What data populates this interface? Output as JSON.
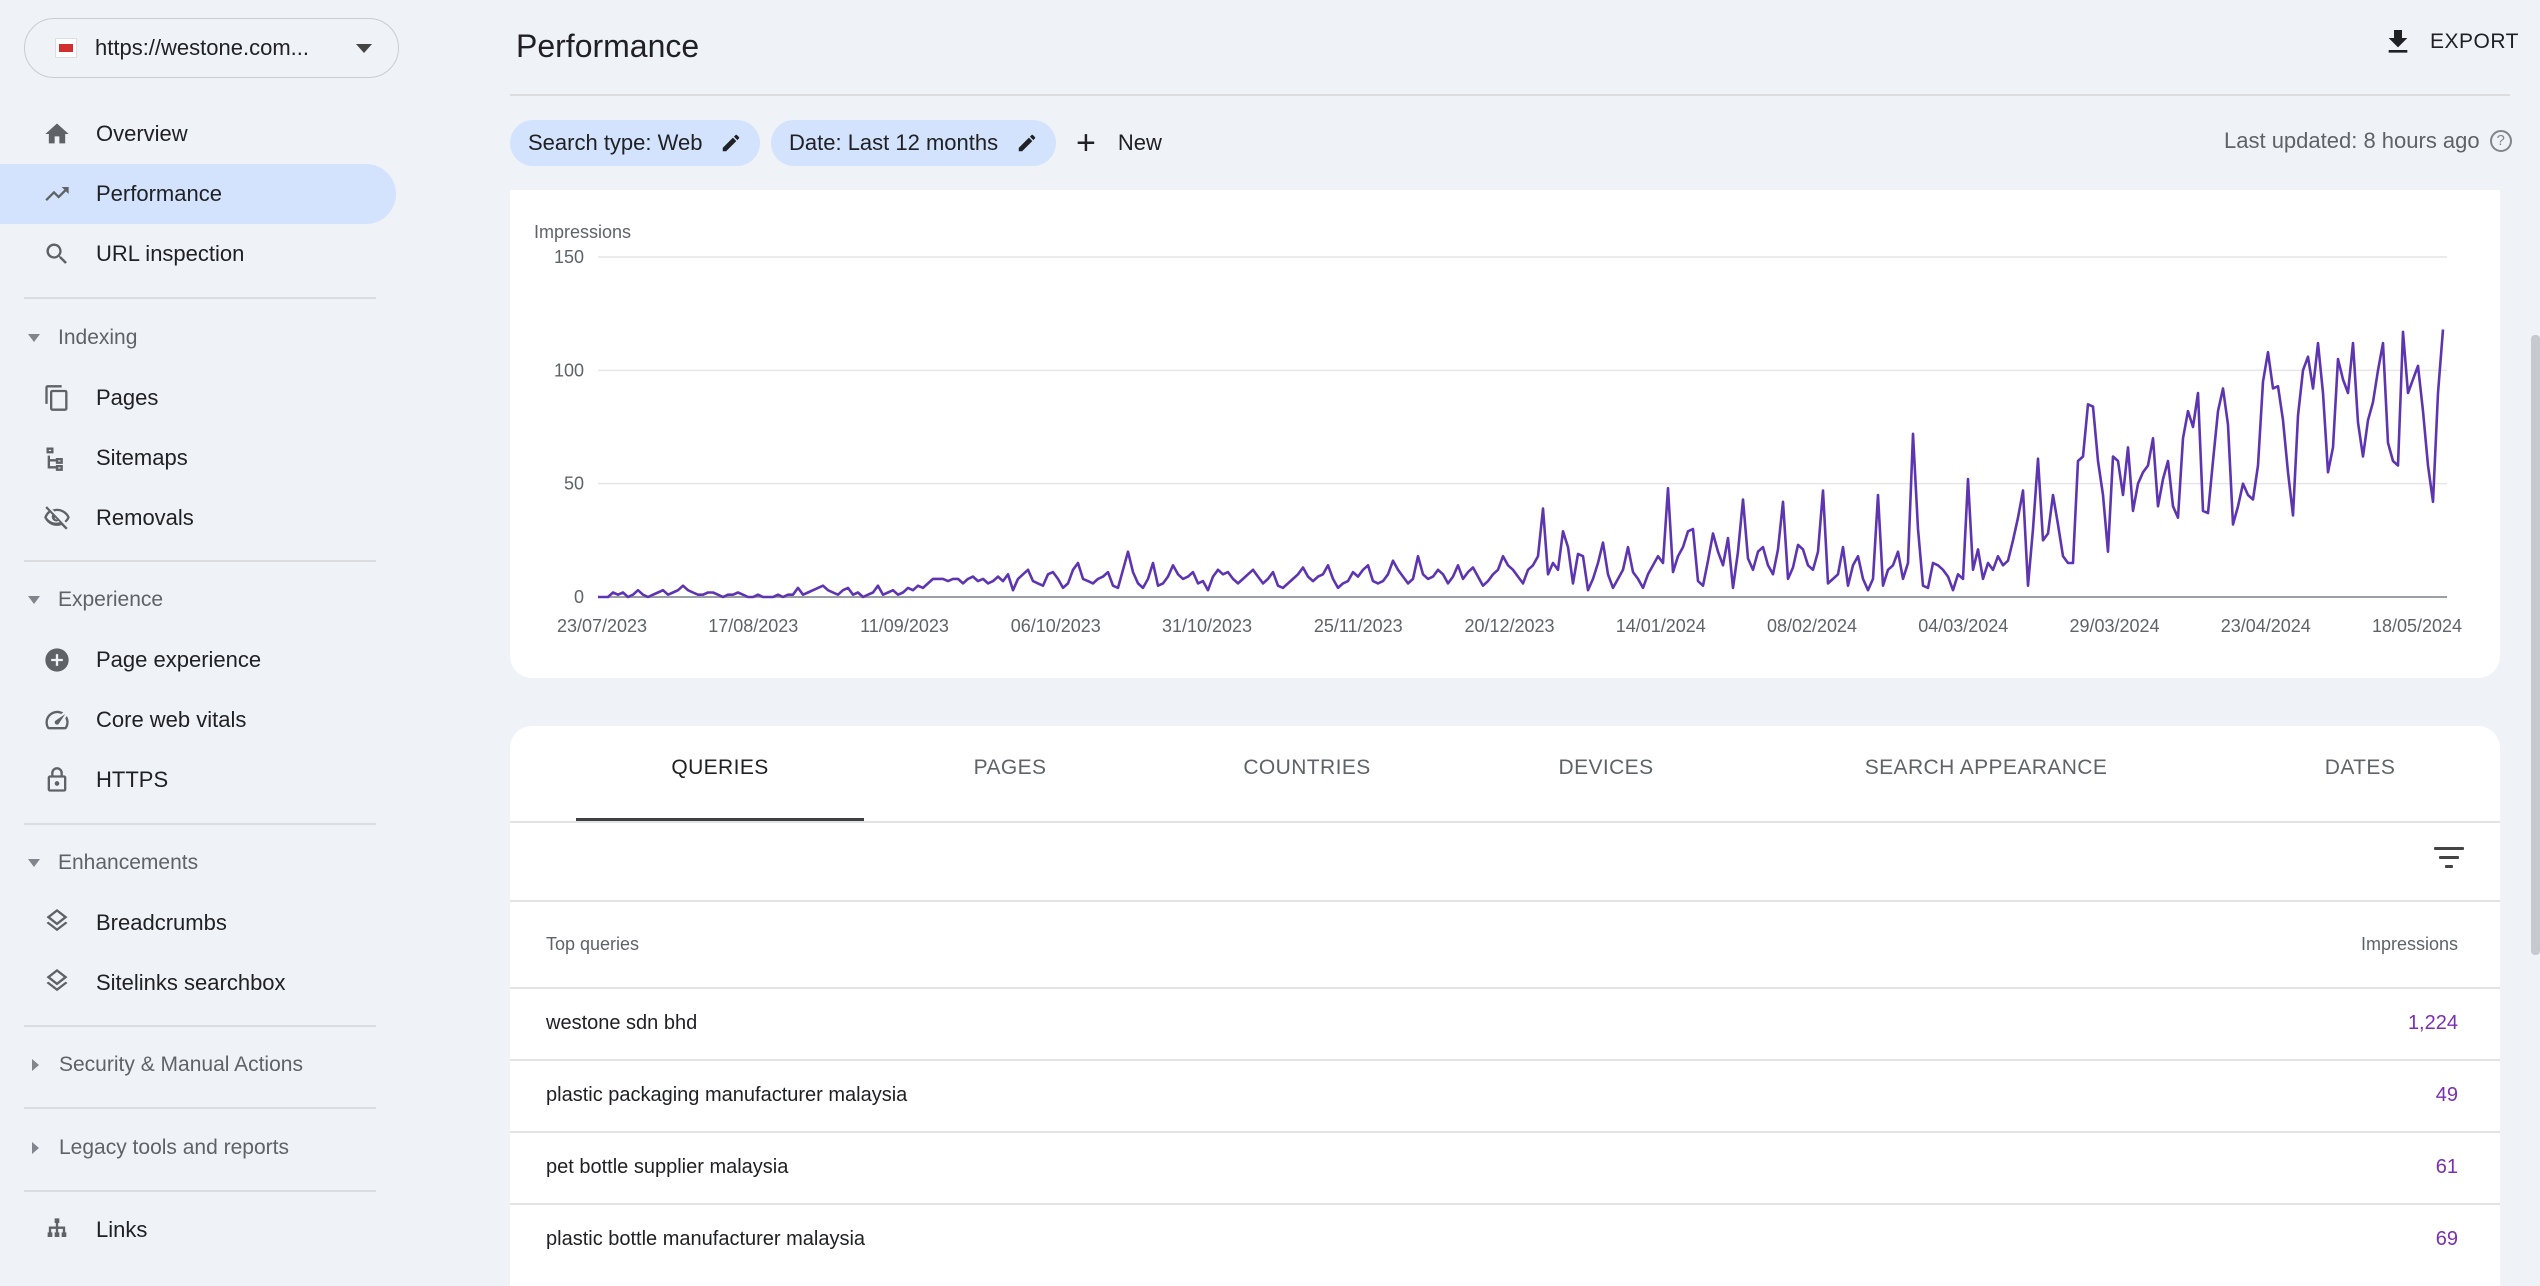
{
  "property": {
    "url": "https://westone.com..."
  },
  "sidebar": {
    "overview": "Overview",
    "performance": "Performance",
    "url_inspection": "URL inspection",
    "indexing": {
      "title": "Indexing",
      "pages": "Pages",
      "sitemaps": "Sitemaps",
      "removals": "Removals"
    },
    "experience": {
      "title": "Experience",
      "page_experience": "Page experience",
      "core_web_vitals": "Core web vitals",
      "https": "HTTPS"
    },
    "enhancements": {
      "title": "Enhancements",
      "breadcrumbs": "Breadcrumbs",
      "sitelinks": "Sitelinks searchbox"
    },
    "security": "Security & Manual Actions",
    "legacy": "Legacy tools and reports",
    "links": "Links"
  },
  "header": {
    "title": "Performance",
    "export": "EXPORT"
  },
  "filters": {
    "search_type": "Search type: Web",
    "date": "Date: Last 12 months",
    "new": "New",
    "last_updated": "Last updated: 8 hours ago"
  },
  "chart_data": {
    "type": "line",
    "ylabel": "Impressions",
    "ylim": [
      0,
      150
    ],
    "yticks": [
      "0",
      "50",
      "100",
      "150"
    ],
    "xticks": [
      "23/07/2023",
      "17/08/2023",
      "11/09/2023",
      "06/10/2023",
      "31/10/2023",
      "25/11/2023",
      "20/12/2023",
      "14/01/2024",
      "08/02/2024",
      "04/03/2024",
      "29/03/2024",
      "23/04/2024",
      "18/05/2024"
    ],
    "x_start": "23/07/2023",
    "x_end": "20/05/2024",
    "color": "#5e35b1",
    "series": [
      {
        "values": [
          0,
          0,
          0,
          2,
          1,
          2,
          0,
          1,
          3,
          1,
          0,
          1,
          2,
          3,
          1,
          2,
          3,
          5,
          3,
          2,
          1,
          1,
          2,
          2,
          1,
          0,
          1,
          1,
          2,
          1,
          0,
          0,
          1,
          0,
          0,
          0,
          1,
          0,
          1,
          1,
          4,
          1,
          2,
          3,
          4,
          5,
          3,
          2,
          1,
          3,
          4,
          1,
          2,
          0,
          1,
          2,
          5,
          1,
          2,
          3,
          1,
          2,
          4,
          3,
          5,
          4,
          6,
          8,
          8,
          8,
          7,
          8,
          8,
          6,
          8,
          9,
          7,
          8,
          6,
          7,
          9,
          7,
          10,
          3,
          8,
          10,
          12,
          7,
          6,
          5,
          10,
          11,
          8,
          4,
          6,
          12,
          15,
          8,
          7,
          6,
          8,
          9,
          11,
          5,
          4,
          12,
          20,
          11,
          6,
          4,
          8,
          15,
          5,
          6,
          9,
          14,
          10,
          8,
          9,
          11,
          6,
          7,
          3,
          9,
          12,
          10,
          11,
          8,
          6,
          8,
          10,
          12,
          9,
          6,
          8,
          11,
          5,
          4,
          6,
          8,
          10,
          13,
          9,
          7,
          9,
          10,
          14,
          8,
          4,
          6,
          7,
          11,
          9,
          12,
          14,
          7,
          6,
          7,
          10,
          16,
          12,
          9,
          6,
          8,
          18,
          10,
          8,
          9,
          12,
          10,
          6,
          9,
          14,
          8,
          11,
          13,
          9,
          5,
          7,
          10,
          12,
          18,
          14,
          12,
          9,
          6,
          12,
          14,
          18,
          39,
          10,
          15,
          12,
          29,
          22,
          6,
          19,
          18,
          3,
          8,
          15,
          24,
          10,
          4,
          8,
          12,
          22,
          11,
          8,
          4,
          10,
          14,
          18,
          15,
          48,
          11,
          18,
          22,
          29,
          30,
          7,
          5,
          16,
          28,
          20,
          14,
          26,
          4,
          20,
          43,
          17,
          12,
          20,
          22,
          14,
          10,
          21,
          42,
          8,
          13,
          23,
          21,
          14,
          12,
          20,
          47,
          6,
          8,
          10,
          22,
          5,
          14,
          18,
          8,
          3,
          8,
          45,
          5,
          12,
          14,
          20,
          8,
          15,
          72,
          30,
          5,
          4,
          15,
          14,
          12,
          9,
          3,
          10,
          8,
          52,
          12,
          21,
          8,
          15,
          12,
          18,
          14,
          16,
          25,
          35,
          47,
          5,
          30,
          61,
          25,
          28,
          45,
          32,
          18,
          15,
          15,
          60,
          62,
          85,
          84,
          60,
          45,
          20,
          62,
          60,
          45,
          66,
          38,
          50,
          55,
          58,
          70,
          40,
          52,
          60,
          40,
          35,
          70,
          82,
          75,
          90,
          38,
          37,
          60,
          82,
          92,
          76,
          32,
          40,
          50,
          45,
          43,
          58,
          95,
          108,
          92,
          93,
          78,
          55,
          36,
          80,
          100,
          106,
          92,
          112,
          90,
          55,
          66,
          105,
          96,
          90,
          112,
          77,
          62,
          78,
          86,
          100,
          112,
          68,
          60,
          58,
          117,
          90,
          96,
          102,
          82,
          58,
          42,
          90,
          118
        ],
        "color": "#5e35b1"
      }
    ]
  },
  "tabs": [
    "QUERIES",
    "PAGES",
    "COUNTRIES",
    "DEVICES",
    "SEARCH APPEARANCE",
    "DATES"
  ],
  "table": {
    "headers": {
      "query": "Top queries",
      "impressions": "Impressions"
    },
    "rows": [
      {
        "query": "westone sdn bhd",
        "impressions": "1,224"
      },
      {
        "query": "plastic packaging manufacturer malaysia",
        "impressions": "49"
      },
      {
        "query": "pet bottle supplier malaysia",
        "impressions": "61"
      },
      {
        "query": "plastic bottle manufacturer malaysia",
        "impressions": "69"
      }
    ]
  },
  "colors": {
    "accent": "#d3e3fd",
    "line": "#5e35b1",
    "value": "#7b2fb5"
  }
}
